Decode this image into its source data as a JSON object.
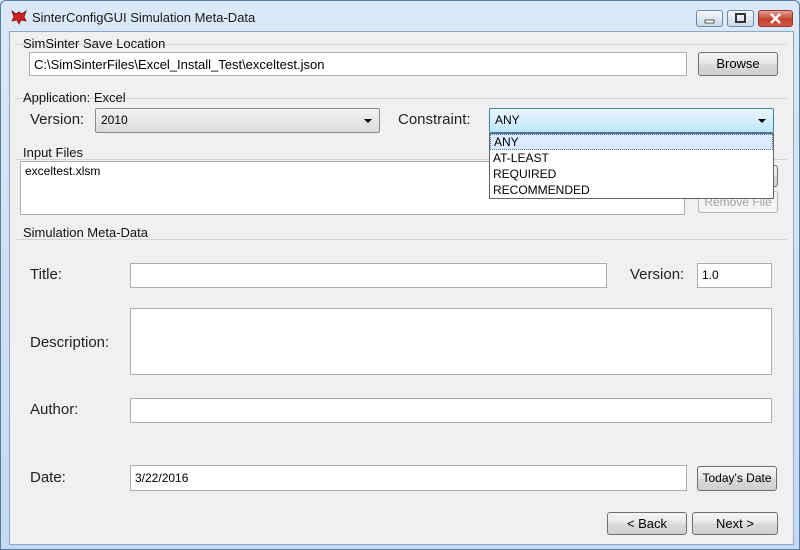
{
  "window": {
    "title": "SinterConfigGUI Simulation Meta-Data"
  },
  "save_location": {
    "group_label": "SimSinter Save Location",
    "path": "C:\\SimSinterFiles\\Excel_Install_Test\\exceltest.json",
    "browse_label": "Browse"
  },
  "application": {
    "group_label": "Application: Excel",
    "version_label": "Version:",
    "version_value": "2010",
    "constraint_label": "Constraint:",
    "constraint_value": "ANY",
    "constraint_options": [
      "ANY",
      "AT-LEAST",
      "REQUIRED",
      "RECOMMENDED"
    ]
  },
  "input_files": {
    "group_label": "Input Files",
    "files": [
      "exceltest.xlsm"
    ],
    "remove_label": "Remove File"
  },
  "metadata": {
    "group_label": "Simulation Meta-Data",
    "title_label": "Title:",
    "title_value": "",
    "version_label": "Version:",
    "version_value": "1.0",
    "description_label": "Description:",
    "description_value": "",
    "author_label": "Author:",
    "author_value": "",
    "date_label": "Date:",
    "date_value": "3/22/2016",
    "todays_date_label": "Today's Date"
  },
  "nav": {
    "back_label": "< Back",
    "next_label": "Next >"
  },
  "icons": {
    "app": "fox-logo-icon",
    "minimize": "minimize-icon",
    "maximize": "maximize-icon",
    "close": "close-icon"
  }
}
